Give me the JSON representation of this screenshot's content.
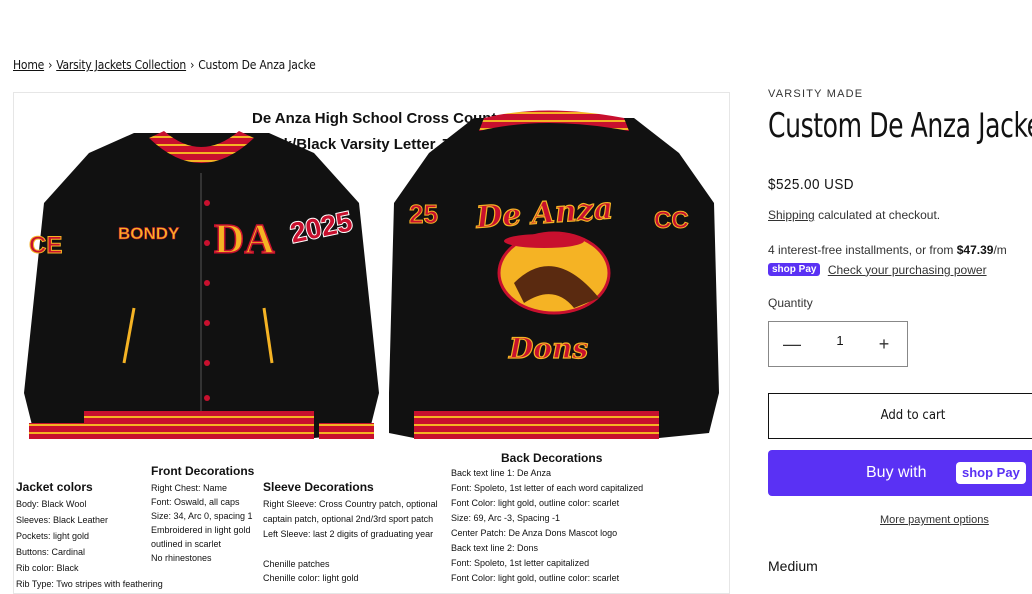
{
  "breadcrumb": {
    "home": "Home",
    "collection": "Varsity Jackets Collection",
    "current": "Custom De Anza Jacke",
    "separator": "›"
  },
  "product": {
    "vendor": "VARSITY MADE",
    "title": "Custom De Anza Jacke",
    "price": "$525.00 USD",
    "shipping_link": "Shipping",
    "tax_note": "calculated at checkout.",
    "installments_prefix": "4 interest-free installments, or from",
    "installments_amount": "$47.39",
    "installments_suffix": "/m",
    "shoppay_badge": "shop Pay",
    "check_power": "Check your purchasing power",
    "quantity_label": "Quantity",
    "quantity_value": "1",
    "minus": "—",
    "plus": "+",
    "add_to_cart": "Add to cart",
    "buy_with": "Buy with",
    "shoppay_pill": "shop Pay",
    "more_payment": "More payment options",
    "variant": "Medium"
  },
  "image": {
    "heading_line1": "De Anza High School Cross Country",
    "heading_line2": "Black/Black Varsity Letter Jacket",
    "chest_name": "BONDY",
    "chest_letters": "DA",
    "sleeve_year": "2025",
    "back_script_top": "De Anza",
    "back_script_bottom": "Dons",
    "front_title": "Front Decorations",
    "front_lines": [
      "Right Chest: Name",
      "Font: Oswald, all caps",
      "Size: 34, Arc 0, spacing 1",
      "Embroidered in light gold",
      "outlined in scarlet",
      "No rhinestones"
    ],
    "colors_title": "Jacket colors",
    "colors_lines": [
      "Body: Black Wool",
      "Sleeves: Black Leather",
      "Pockets: light gold",
      "Buttons: Cardinal",
      "Rib color: Black",
      "Rib Type: Two stripes with feathering"
    ],
    "sleeve_title": "Sleeve Decorations",
    "sleeve_lines": [
      "Right Sleeve: Cross Country patch, optional",
      "captain patch, optional 2nd/3rd sport patch",
      "Left Sleeve: last 2 digits of graduating year",
      "",
      "Chenille patches",
      "Chenille color: light gold"
    ],
    "back_title": "Back Decorations",
    "back_lines": [
      "Back text line 1: De Anza",
      "Font: Spoleto, 1st letter of each word capitalized",
      "Font Color: light gold, outline color: scarlet",
      "Size: 69, Arc -3, Spacing -1",
      "Center Patch: De Anza Dons Mascot logo",
      "Back text line 2: Dons",
      "Font: Spoleto, 1st letter capitalized",
      "Font Color: light gold, outline color: scarlet"
    ]
  },
  "colors": {
    "shoppay": "#5a31f4",
    "jacket_body": "#111111",
    "gold": "#f5b324",
    "scarlet": "#c8102e"
  }
}
